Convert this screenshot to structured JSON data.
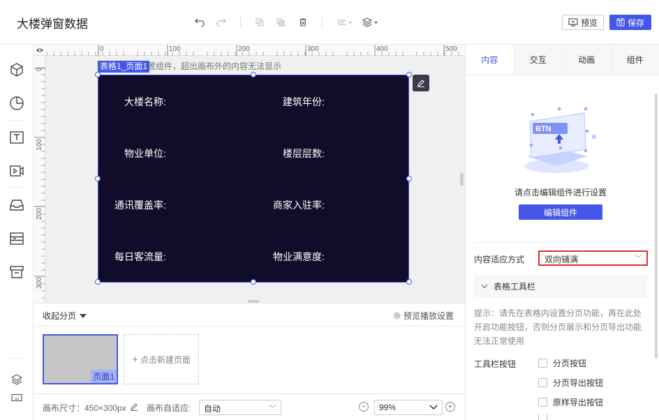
{
  "header": {
    "title": "大楼弹窗数据",
    "preview_label": "预览",
    "save_label": "保存",
    "icons": [
      "undo-icon",
      "redo-icon",
      "copy-icon",
      "paste-icon",
      "delete-icon",
      "align-icon",
      "layer-icon"
    ]
  },
  "leftbar": {
    "icons": [
      "cube-icon",
      "chart-pie-icon",
      "text-icon",
      "video-icon",
      "inbox-icon",
      "table-icon",
      "archive-icon",
      "layers-icon",
      "keyboard-icon"
    ]
  },
  "canvas": {
    "ruler_top_labels": [
      "0",
      "100",
      "200",
      "300",
      "400",
      "500"
    ],
    "ruler_left_labels": [
      "0",
      "100",
      "200",
      "300"
    ],
    "selection_tag": "表格1_页面1",
    "hint": "置组件，超出画布外的内容无法显示",
    "fields": [
      {
        "label": "大楼名称:"
      },
      {
        "label": "建筑年份:"
      },
      {
        "label": "物业单位:"
      },
      {
        "label": "楼层层数:"
      },
      {
        "label": "通讯覆盖率:"
      },
      {
        "label": "商家入驻率:"
      },
      {
        "label": "每日客流量:"
      },
      {
        "label": "物业满意度:"
      }
    ],
    "panel_color": "#110c2a"
  },
  "pages": {
    "collapse_label": "收起分页",
    "settings_label": "预览播放设置",
    "page_label": "页面1",
    "new_page_label": "点击新建页面"
  },
  "bottom": {
    "canvas_size_label": "画布尺寸：450×300px",
    "adapt_label": "画布自适应:",
    "adapt_value": "自动",
    "zoom_value": "99%"
  },
  "right": {
    "tabs": [
      "内容",
      "交互",
      "动画",
      "组件"
    ],
    "active_tab": "内容",
    "illustration_text": "BTN",
    "prompt": "请点击编辑组件进行设置",
    "edit_button": "编辑组件",
    "fit_label": "内容适应方式",
    "fit_value": "双向铺满",
    "section_title": "表格工具栏",
    "hint": "提示：请先在表格内设置分页功能，再在此处开启功能按钮，否则分页展示和分页导出功能无法正常使用",
    "toolbar_buttons_label": "工具栏按钮",
    "checkboxes": [
      "分页按钮",
      "分页导出按钮",
      "原样导出按钮"
    ]
  },
  "colors": {
    "accent": "#4557e8",
    "highlight_border": "#e02e2e"
  }
}
